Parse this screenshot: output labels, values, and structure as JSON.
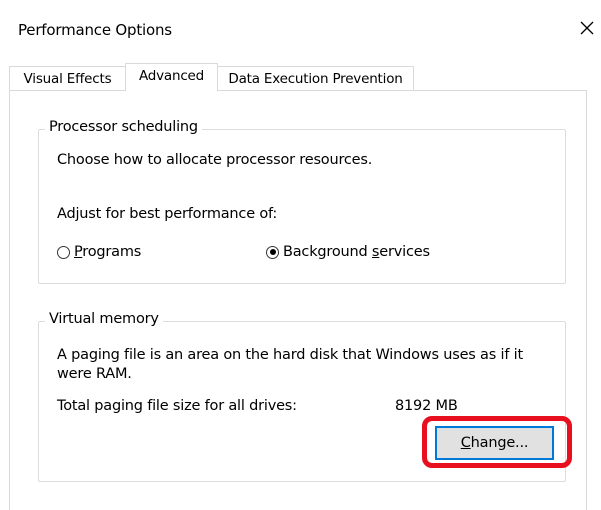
{
  "window": {
    "title": "Performance Options",
    "close_glyph": "✕"
  },
  "tabs": [
    {
      "label": "Visual Effects"
    },
    {
      "label": "Advanced",
      "active": true
    },
    {
      "label": "Data Execution Prevention"
    }
  ],
  "processor_scheduling": {
    "legend": "Processor scheduling",
    "description": "Choose how to allocate processor resources.",
    "adjust_label": "Adjust for best performance of:",
    "options": [
      {
        "mnemonic": "P",
        "rest": "rograms",
        "selected": false
      },
      {
        "prefix": "Background ",
        "mnemonic": "s",
        "rest": "ervices",
        "selected": true
      }
    ]
  },
  "virtual_memory": {
    "legend": "Virtual memory",
    "description": "A paging file is an area on the hard disk that Windows uses as if it were RAM.",
    "total_label": "Total paging file size for all drives:",
    "total_value": "8192 MB",
    "change_button": {
      "mnemonic": "C",
      "rest": "hange..."
    }
  },
  "colors": {
    "highlight": "#e8101f",
    "focus": "#0078d7",
    "button_bg": "#e1e1e1"
  }
}
